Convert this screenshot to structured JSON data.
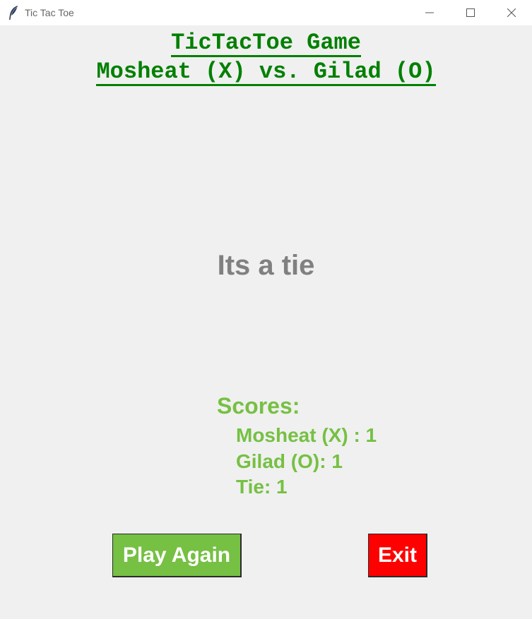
{
  "window": {
    "title": "Tic Tac Toe",
    "icon": "feather-icon",
    "controls": [
      "minimize-icon",
      "maximize-icon",
      "close-icon"
    ]
  },
  "header": {
    "title": "TicTacToe Game",
    "matchup": "Mosheat (X) vs. Gilad (O)"
  },
  "status": "Its a tie",
  "scores": {
    "title": "Scores:",
    "player_x": "Mosheat (X) : 1",
    "player_o": "Gilad (O): 1",
    "tie": "Tie: 1"
  },
  "buttons": {
    "play_again": "Play Again",
    "exit": "Exit"
  },
  "colors": {
    "heading": "#008000",
    "status": "#808080",
    "scores": "#76c043",
    "play_again_bg": "#76c043",
    "exit_bg": "#ff0000",
    "background": "#f0f0f0"
  }
}
